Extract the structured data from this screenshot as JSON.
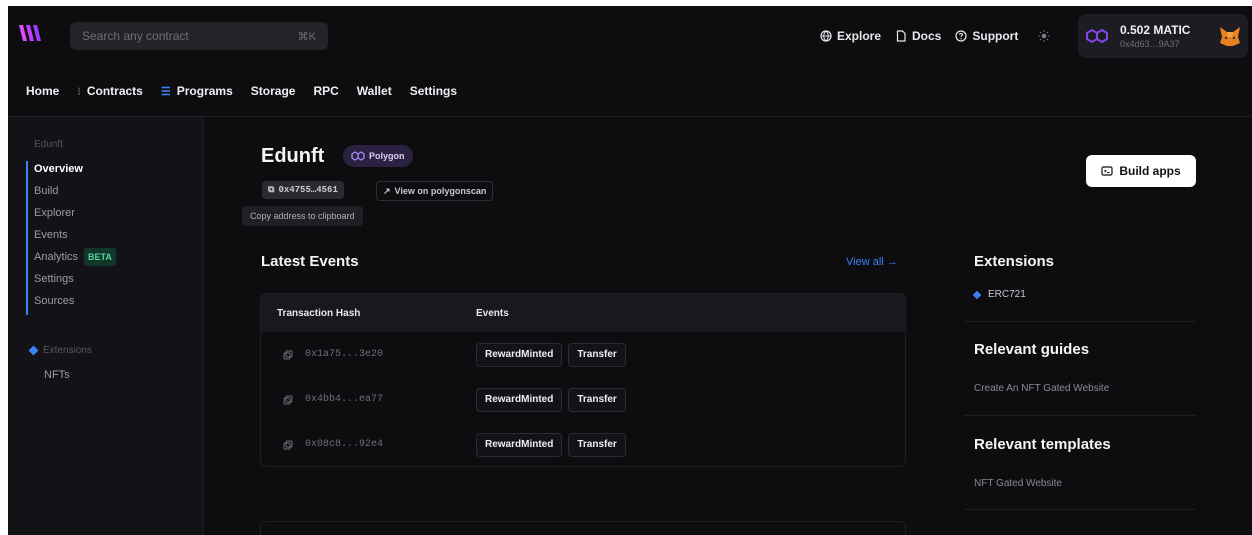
{
  "colors": {
    "accent": "#3b82f6",
    "background": "#0d0d10",
    "beta": "#57d69d",
    "polygon": "#8247e5"
  },
  "topbar": {
    "search_placeholder": "Search any contract",
    "search_shortcut": "⌘K",
    "links": [
      "Explore",
      "Docs",
      "Support"
    ],
    "wallet": {
      "balance": "0.502 MATIC",
      "address": "0x4d63…9A37"
    }
  },
  "nav": {
    "items": [
      "Home",
      "Contracts",
      "Programs",
      "Storage",
      "RPC",
      "Wallet",
      "Settings"
    ]
  },
  "sidebar": {
    "section": "Edunft",
    "items": [
      "Overview",
      "Build",
      "Explorer",
      "Events",
      "Analytics",
      "Settings",
      "Sources"
    ],
    "beta": "BETA",
    "extensions_label": "Extensions",
    "extension_items": [
      "NFTs"
    ]
  },
  "contract": {
    "name": "Edunft",
    "chain": "Polygon",
    "address_short": "0x4755…4561",
    "view_on_scan": "View on polygonscan",
    "copy_tooltip": "Copy address to clipboard",
    "build_button": "Build apps"
  },
  "events": {
    "title": "Latest Events",
    "view_all": "View all →",
    "columns": [
      "Transaction Hash",
      "Events"
    ],
    "rows": [
      {
        "hash": "0x1a75...3e20",
        "events": [
          "RewardMinted",
          "Transfer"
        ]
      },
      {
        "hash": "0x4bb4...ea77",
        "events": [
          "RewardMinted",
          "Transfer"
        ]
      },
      {
        "hash": "0x08c8...92e4",
        "events": [
          "RewardMinted",
          "Transfer"
        ]
      }
    ]
  },
  "right": {
    "extensions_title": "Extensions",
    "extension": "ERC721",
    "guides_title": "Relevant guides",
    "guide": "Create An NFT Gated Website",
    "templates_title": "Relevant templates",
    "template": "NFT Gated Website"
  }
}
